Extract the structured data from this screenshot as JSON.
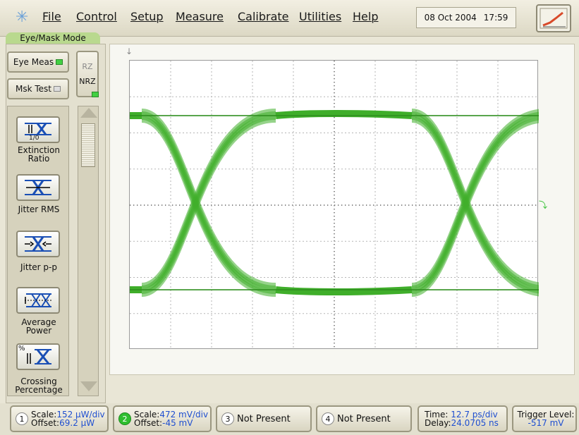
{
  "menubar": {
    "items": [
      "File",
      "Control",
      "Setup",
      "Measure",
      "Calibrate",
      "Utilities",
      "Help"
    ],
    "date": "08 Oct 2004",
    "time": "17:59"
  },
  "mode_label": "Eye/Mask Mode",
  "mode_buttons": {
    "eye_meas": "Eye Meas",
    "msk_test": "Msk Test"
  },
  "signal_type": {
    "rz": "RZ",
    "nrz": "NRZ"
  },
  "measurements": [
    {
      "label": "Extinction Ratio",
      "icon": "extinction-ratio-icon",
      "glyph": "1/0"
    },
    {
      "label": "Jitter RMS",
      "icon": "jitter-rms-icon"
    },
    {
      "label": "Jitter p-p",
      "icon": "jitter-pp-icon"
    },
    {
      "label": "Average Power",
      "icon": "average-power-icon"
    },
    {
      "label": "Crossing Percentage",
      "icon": "crossing-percentage-icon",
      "glyph": "%"
    }
  ],
  "channels": [
    {
      "num": "1",
      "line1": "Scale:",
      "value1": "152 µW/div",
      "line2": "Offset:",
      "value2": "69.2 µW"
    },
    {
      "num": "2",
      "line1": "Scale:",
      "value1": "472 mV/div",
      "line2": "Offset:",
      "value2": "-45 mV"
    },
    {
      "num": "3",
      "text": "Not Present"
    },
    {
      "num": "4",
      "text": "Not Present"
    }
  ],
  "timebase": {
    "time_label": "Time:",
    "time_value": "12.7 ps/div",
    "delay_label": "Delay:",
    "delay_value": "24.0705 ns"
  },
  "trigger": {
    "label": "Trigger Level:",
    "value": "-517 mV"
  },
  "colors": {
    "trace": "#3fae2a",
    "trace_dark": "#2f8f1f",
    "accent": "#1f4fd0",
    "led_on": "#43d043"
  }
}
